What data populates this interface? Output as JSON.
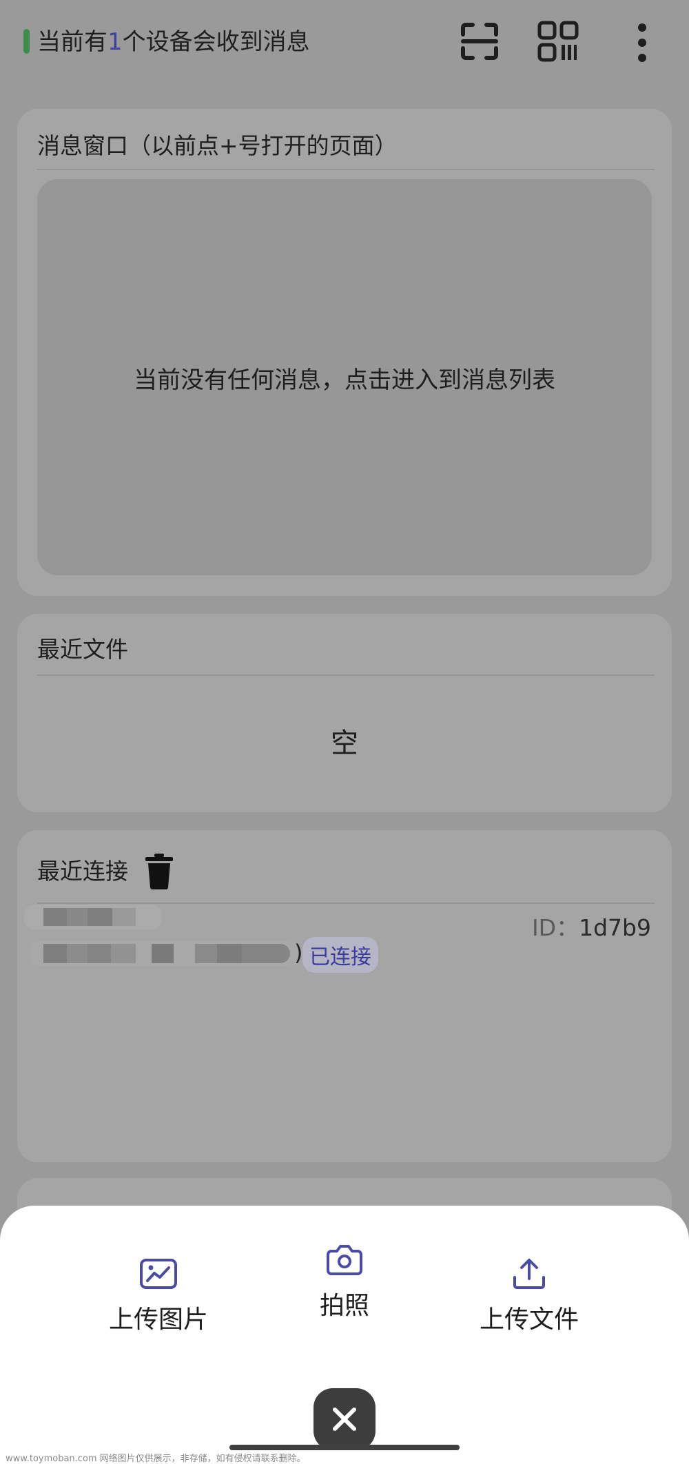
{
  "header": {
    "status_prefix": "当前有",
    "device_count": "1",
    "status_suffix": "个设备会收到消息",
    "icons": [
      "scan-icon",
      "qrcode-icon",
      "more-vertical-icon"
    ],
    "status_color": "#3c8f4b"
  },
  "message_window": {
    "title": "消息窗口（以前点+号打开的页面）",
    "empty_text": "当前没有任何消息，点击进入到消息列表"
  },
  "recent_files": {
    "title": "最近文件",
    "empty_text": "空"
  },
  "recent_connections": {
    "title": "最近连接",
    "items": [
      {
        "id_label": "ID：",
        "id_value": "1d7b9",
        "paren": ")",
        "status": "已连接"
      }
    ]
  },
  "bottom_sheet": {
    "actions": [
      {
        "label": "上传图片",
        "icon": "image-upload-icon"
      },
      {
        "label": "拍照",
        "icon": "camera-icon"
      },
      {
        "label": "上传文件",
        "icon": "file-upload-icon"
      }
    ],
    "accent_color": "#4a4aa8"
  },
  "watermark": "www.toymoban.com 网络图片仅供展示，非存储，如有侵权请联系删除。"
}
